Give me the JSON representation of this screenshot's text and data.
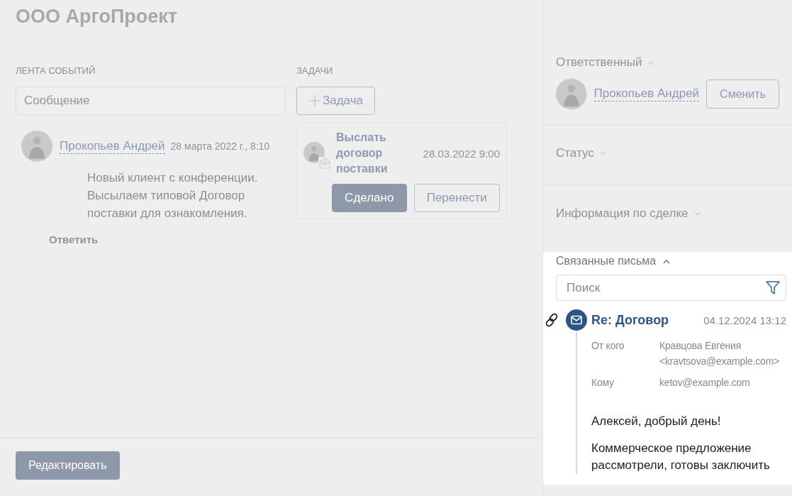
{
  "title": "ООО АргоПроект",
  "feed": {
    "heading": "ЛЕНТА СОБЫТИЙ",
    "message_placeholder": "Сообщение",
    "events": [
      {
        "author": "Прокопьев Андрей",
        "time": "28 марта 2022 г., 8:10",
        "text": "Новый клиент с конференции. Высылаем типовой Договор поставки для ознакомления.",
        "reply": "Ответить"
      }
    ]
  },
  "tasks": {
    "heading": "ЗАДАЧИ",
    "add_button": "Задача",
    "items": [
      {
        "title": "Выслать договор поставки",
        "due": "28.03.2022 9:00",
        "actions": [
          {
            "label": "Сделано",
            "kind": "primary"
          },
          {
            "label": "Перенести",
            "kind": "secondary"
          }
        ]
      }
    ]
  },
  "sidebar": {
    "sections": [
      {
        "kind": "responsible",
        "title": "Ответственный",
        "expanded": true,
        "person": "Прокопьев Андрей",
        "button": "Сменить"
      },
      {
        "kind": "plain",
        "title": "Статус",
        "expanded": false
      },
      {
        "kind": "plain",
        "title": "Информация по сделке",
        "expanded": false
      }
    ]
  },
  "linked_mail": {
    "title": "Связанные письма",
    "expanded": true,
    "search_placeholder": "Поиск",
    "letters": [
      {
        "subject": "Re: Договор",
        "date": "04.12.2024 13:12",
        "fields": [
          {
            "label": "От кого",
            "value": "Кравцова Евгения <kravtsova@example.com>"
          },
          {
            "label": "Кому",
            "value": "ketov@example.com"
          }
        ],
        "body": [
          "Алексей, добрый день!",
          "Коммерческое предложение рассмотрели, готовы заключить"
        ]
      }
    ]
  },
  "footer": {
    "edit_button": "Редактировать"
  }
}
